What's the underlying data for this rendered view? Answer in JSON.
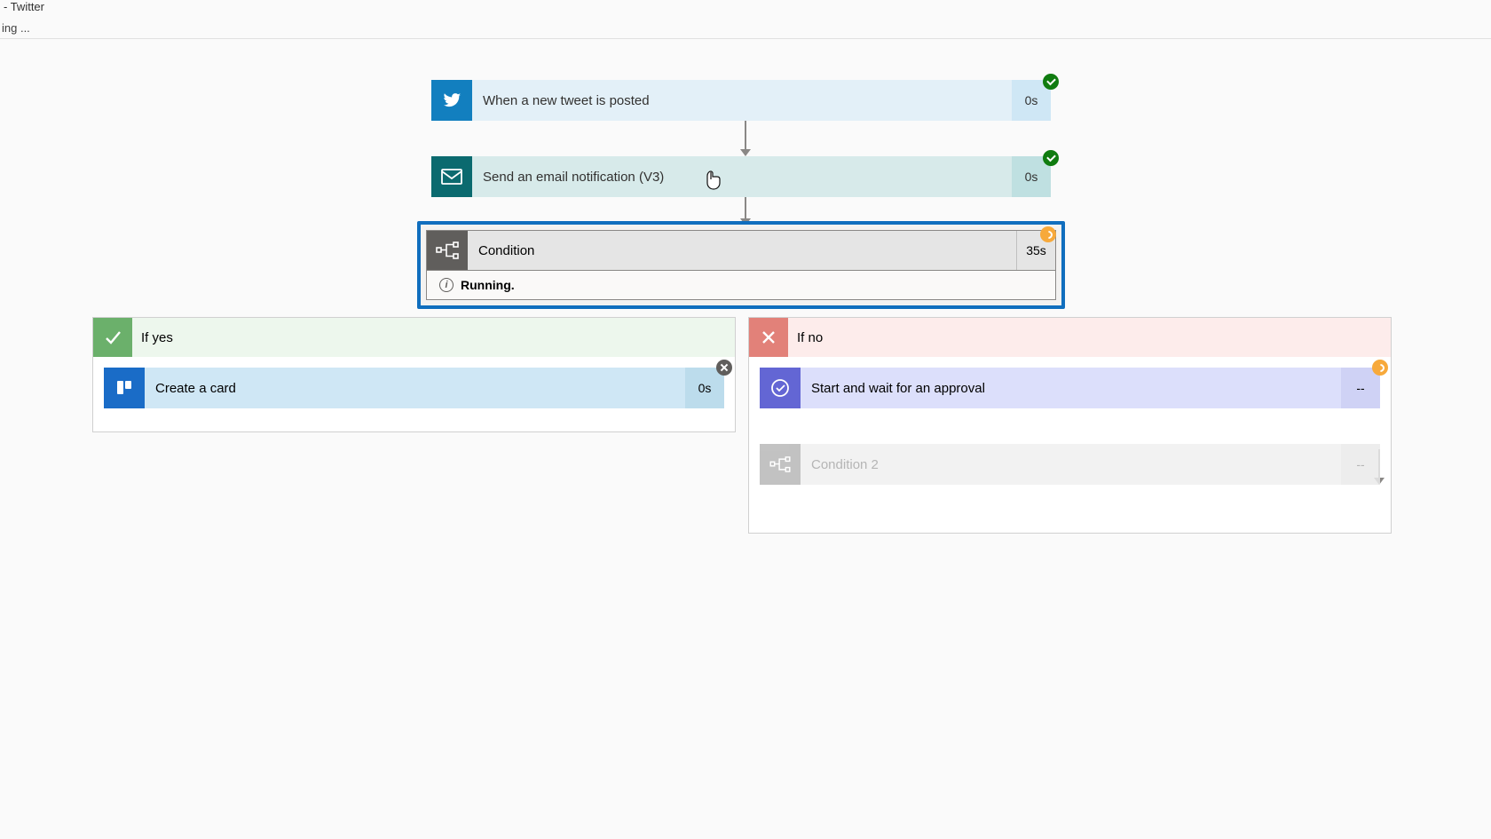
{
  "window": {
    "title": "- Twitter",
    "status": "ing ..."
  },
  "flow": {
    "trigger": {
      "label": "When a new tweet is posted",
      "duration": "0s",
      "status": "success",
      "icon": "twitter",
      "icon_bg": "#127fbf",
      "body_bg": "#e3f0f8",
      "time_bg": "#cfe7f5"
    },
    "email": {
      "label": "Send an email notification (V3)",
      "duration": "0s",
      "status": "success",
      "icon": "mail",
      "icon_bg": "#0b6a6f",
      "body_bg": "#d7eaea",
      "time_bg": "#bfe0e1"
    },
    "condition": {
      "label": "Condition",
      "duration": "35s",
      "status_text": "Running.",
      "badge": "pending"
    }
  },
  "branches": {
    "yes": {
      "title": "If yes",
      "actions": [
        {
          "name": "create-card",
          "label": "Create a card",
          "duration": "0s",
          "icon": "trello",
          "icon_bg": "#1a6cc7",
          "body_bg": "#cfe7f5",
          "time_bg": "#bcdcec",
          "badge": "cancel"
        }
      ]
    },
    "no": {
      "title": "If no",
      "actions": [
        {
          "name": "approval",
          "label": "Start and wait for an approval",
          "duration": "--",
          "icon": "approval",
          "icon_bg": "#6366d4",
          "body_bg": "#dcdffb",
          "time_bg": "#cfd2f5",
          "badge": "pending"
        },
        {
          "name": "condition2",
          "label": "Condition 2",
          "duration": "--",
          "icon": "condition",
          "icon_bg": "#b8b8b8",
          "body_bg": "#f0f0f0",
          "time_bg": "#eaeaea",
          "text_color": "#a9a9a9"
        }
      ]
    }
  }
}
